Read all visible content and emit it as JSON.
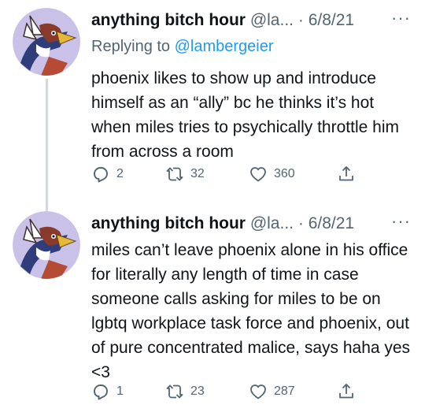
{
  "tweets": [
    {
      "author_name": "anything bitch hour",
      "handle": "@la...",
      "dot": "·",
      "date": "6/8/21",
      "more_label": "···",
      "replying_prefix": "Replying to",
      "replying_to": "@lambergeier",
      "text": "phoenix likes to show up and introduce himself as an “ally” bc he thinks it’s hot when miles tries to psychically throttle him from across a room",
      "replies": "2",
      "retweets": "32",
      "likes": "360"
    },
    {
      "author_name": "anything bitch hour",
      "handle": "@la...",
      "dot": "·",
      "date": "6/8/21",
      "more_label": "···",
      "text": "miles can’t leave phoenix alone in his office for literally any length of time in case someone calls asking for miles to be on lgbtq workplace task force and phoenix, out of pure concentrated malice, says haha yes <3",
      "replies": "1",
      "retweets": "23",
      "likes": "287"
    }
  ],
  "icons": {
    "reply": "reply-icon",
    "retweet": "retweet-icon",
    "like": "heart-icon",
    "share": "share-icon",
    "more": "more-icon"
  },
  "colors": {
    "text": "#0f1419",
    "secondary": "#536471",
    "link": "#1d9bf0",
    "thread_line": "#cfd9de",
    "avatar_bg": "#c9c1e8"
  }
}
